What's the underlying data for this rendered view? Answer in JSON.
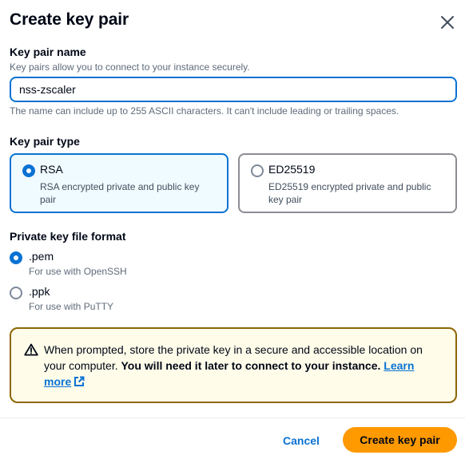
{
  "dialog": {
    "title": "Create key pair",
    "close_icon": "close-icon"
  },
  "key_pair_name": {
    "label": "Key pair name",
    "description": "Key pairs allow you to connect to your instance securely.",
    "value": "nss-zscaler",
    "constraint": "The name can include up to 255 ASCII characters. It can't include leading or trailing spaces."
  },
  "key_pair_type": {
    "label": "Key pair type",
    "selected": "RSA",
    "options": [
      {
        "title": "RSA",
        "description": "RSA encrypted private and public key pair",
        "selected": true
      },
      {
        "title": "ED25519",
        "description": "ED25519 encrypted private and public key pair",
        "selected": false
      }
    ]
  },
  "private_key_format": {
    "label": "Private key file format",
    "selected": ".pem",
    "options": [
      {
        "title": ".pem",
        "description": "For use with OpenSSH",
        "selected": true
      },
      {
        "title": ".ppk",
        "description": "For use with PuTTY",
        "selected": false
      }
    ]
  },
  "alert": {
    "icon": "warning-icon",
    "text_plain": "When prompted, store the private key in a secure and accessible location on your computer.",
    "text_bold": "You will need it later to connect to your instance.",
    "link_label": "Learn more",
    "link_icon": "external-link-icon"
  },
  "footer": {
    "cancel_label": "Cancel",
    "submit_label": "Create key pair"
  },
  "colors": {
    "accent": "#0972d3",
    "primary_button": "#ff9900",
    "warning_border": "#8d6605",
    "warning_background": "#fffce9"
  }
}
